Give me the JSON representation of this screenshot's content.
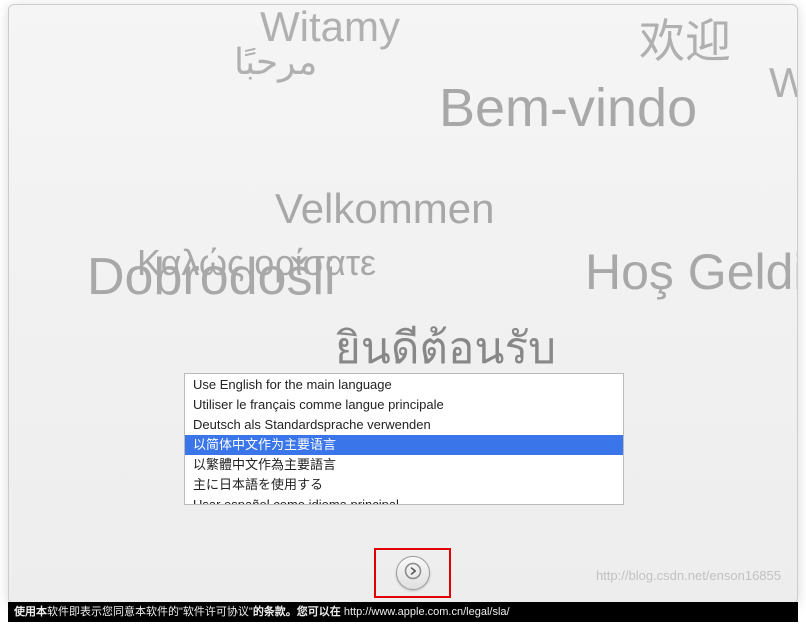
{
  "background_greetings": {
    "witamy": "Witamy",
    "huanying": "欢迎",
    "marhaba": "مرحبًا",
    "wi": "Wi",
    "bemvindo": "Bem-vindo",
    "velkommen": "Velkommen",
    "kalos": "Καλώς ορίσατε",
    "dobrodosli": "Dobrodošli",
    "hosgeldi": "Hoş Geldi",
    "thai": "ยินดีต้อนรับ"
  },
  "languages": [
    {
      "label": "Use English for the main language",
      "selected": false
    },
    {
      "label": "Utiliser le français comme langue principale",
      "selected": false
    },
    {
      "label": "Deutsch als Standardsprache verwenden",
      "selected": false
    },
    {
      "label": "以简体中文作为主要语言",
      "selected": true
    },
    {
      "label": "以繁體中文作為主要語言",
      "selected": false
    },
    {
      "label": "主に日本語を使用する",
      "selected": false
    },
    {
      "label": "Usar español como idioma principal",
      "selected": false
    }
  ],
  "footer": {
    "prefix": "使用本",
    "middle": "软件即表示您同意本软件的\"软件许可协议\"",
    "suffix": "的条款。您可以在 ",
    "url": "http://www.apple.com.cn/legal/sla/"
  },
  "watermark": "http://blog.csdn.net/enson16855"
}
